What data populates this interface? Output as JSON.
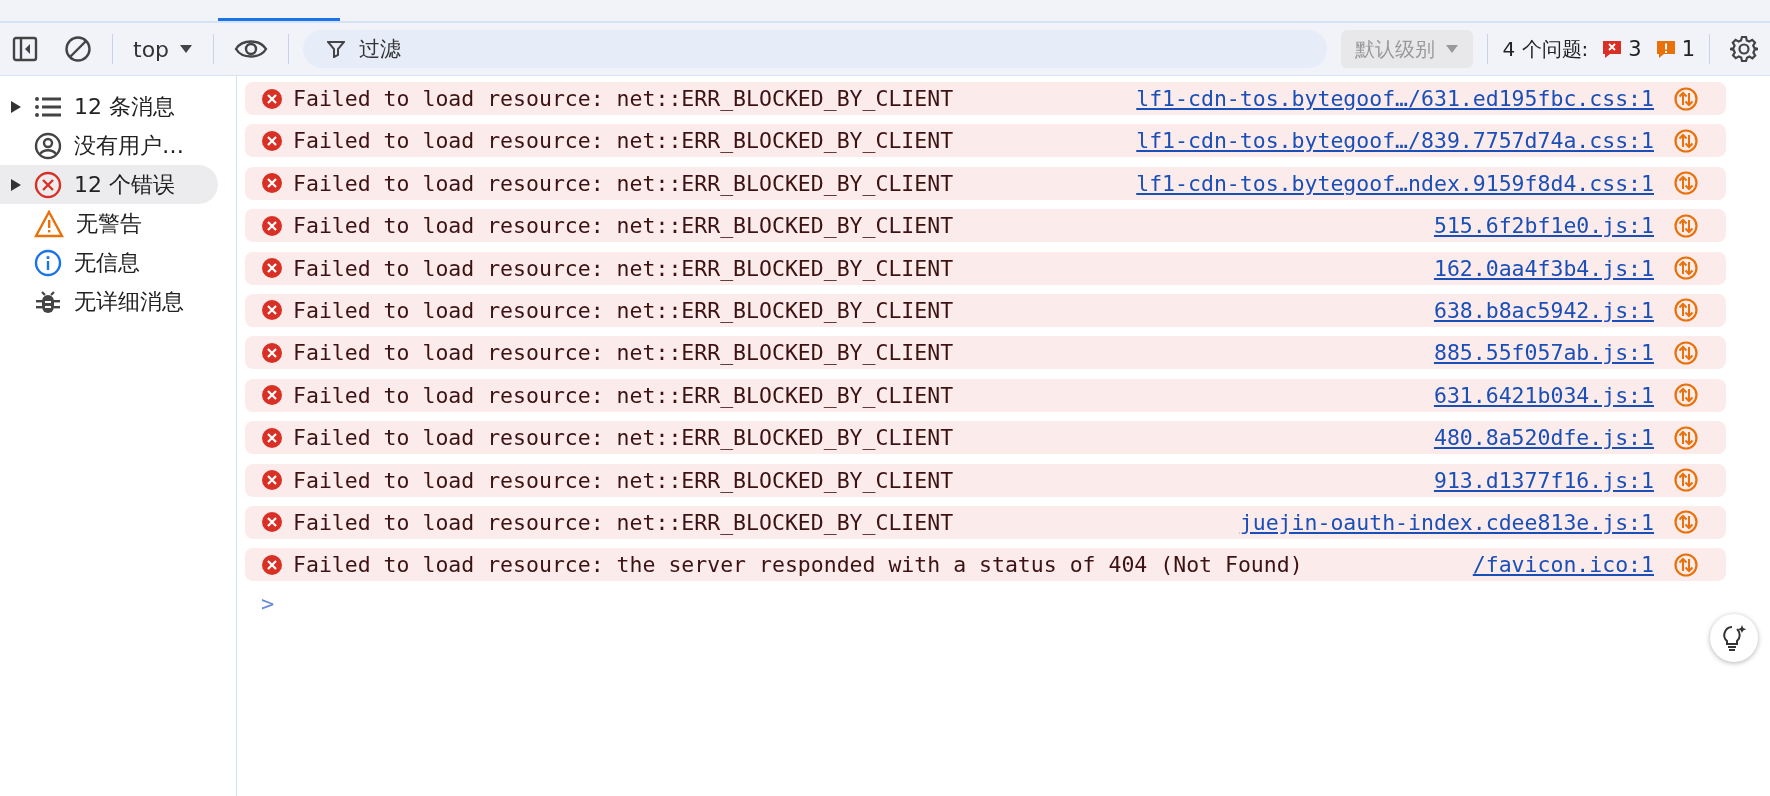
{
  "toolbar": {
    "context": "top",
    "filter_placeholder": "过滤",
    "level_button": "默认级别",
    "issues_label": "4 个问题:",
    "issue_counts": [
      {
        "kind": "error",
        "count": "3"
      },
      {
        "kind": "warning",
        "count": "1"
      }
    ]
  },
  "sidebar": {
    "items": [
      {
        "kind": "list",
        "label": "12 条消息",
        "expandable": true,
        "selected": false
      },
      {
        "kind": "user",
        "label": "没有用户…",
        "expandable": false,
        "selected": false
      },
      {
        "kind": "error",
        "label": "12 个错误",
        "expandable": true,
        "selected": true
      },
      {
        "kind": "warning",
        "label": "无警告",
        "expandable": false,
        "selected": false
      },
      {
        "kind": "info",
        "label": "无信息",
        "expandable": false,
        "selected": false
      },
      {
        "kind": "verbose",
        "label": "无详细消息",
        "expandable": false,
        "selected": false
      }
    ]
  },
  "messages": [
    {
      "text": "Failed to load resource: net::ERR_BLOCKED_BY_CLIENT",
      "source": "lf1-cdn-tos.bytegoof…/631.ed195fbc.css:1"
    },
    {
      "text": "Failed to load resource: net::ERR_BLOCKED_BY_CLIENT",
      "source": "lf1-cdn-tos.bytegoof…/839.7757d74a.css:1"
    },
    {
      "text": "Failed to load resource: net::ERR_BLOCKED_BY_CLIENT",
      "source": "lf1-cdn-tos.bytegoof…ndex.9159f8d4.css:1"
    },
    {
      "text": "Failed to load resource: net::ERR_BLOCKED_BY_CLIENT",
      "source": "515.6f2bf1e0.js:1"
    },
    {
      "text": "Failed to load resource: net::ERR_BLOCKED_BY_CLIENT",
      "source": "162.0aa4f3b4.js:1"
    },
    {
      "text": "Failed to load resource: net::ERR_BLOCKED_BY_CLIENT",
      "source": "638.b8ac5942.js:1"
    },
    {
      "text": "Failed to load resource: net::ERR_BLOCKED_BY_CLIENT",
      "source": "885.55f057ab.js:1"
    },
    {
      "text": "Failed to load resource: net::ERR_BLOCKED_BY_CLIENT",
      "source": "631.6421b034.js:1"
    },
    {
      "text": "Failed to load resource: net::ERR_BLOCKED_BY_CLIENT",
      "source": "480.8a520dfe.js:1"
    },
    {
      "text": "Failed to load resource: net::ERR_BLOCKED_BY_CLIENT",
      "source": "913.d1377f16.js:1"
    },
    {
      "text": "Failed to load resource: net::ERR_BLOCKED_BY_CLIENT",
      "source": "juejin-oauth-index.cdee813e.js:1"
    },
    {
      "text": "Failed to load resource: the server responded with a status of 404 (Not Found)",
      "source": "/favicon.ico:1"
    }
  ],
  "prompt": ">"
}
